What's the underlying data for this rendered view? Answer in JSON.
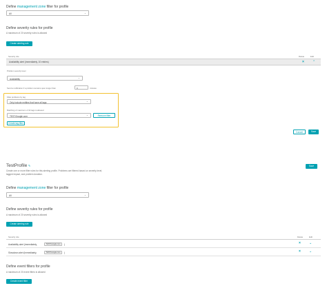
{
  "profile1": {
    "mgmt_prefix": "Define ",
    "mgmt_link": "management zone",
    "mgmt_suffix": " filter for profile",
    "mgmt_select": "All",
    "severity_title": "Define severity rules for profile",
    "severity_hint": "A maximum of 20 severity rules is allowed",
    "create_rule_btn": "Create alerting rule",
    "col_severity": "Severity rule",
    "col_delete": "Delete",
    "col_edit": "Edit",
    "expanded_row_label": "Availability alert (immediately, 10 entries)",
    "problem_severity_label": "Problem severity level",
    "problem_severity_value": "Availability",
    "notification_prefix": "Send a notification if a problem remains open longer than",
    "notification_value": "0",
    "notification_suffix": "minutes",
    "filter_by_tag_label": "Filter problems by tag",
    "filter_by_tag_value": "Only include entities that have all tags",
    "tag_matching_label": "Matching of maximum of 10 tags is allowed",
    "tag_value": "TEST:Google.com",
    "remove_filter_btn": "Remove filter",
    "create_tag_filter_btn": "Create tag filter",
    "cancel_btn": "Cancel",
    "save_btn": "Save"
  },
  "profile2": {
    "name": "TestProfile",
    "description": "Create one or more filter rules for this alerting profile. Problems are filtered based on severity level, tagged impact, and problem duration.",
    "save_btn": "Save",
    "mgmt_prefix": "Define ",
    "mgmt_link": "management zone",
    "mgmt_suffix": " filter for profile",
    "mgmt_select": "All",
    "severity_title": "Define severity rules for profile",
    "severity_hint": "A maximum of 20 severity rules is allowed",
    "create_rule_btn": "Create alerting rule",
    "col_severity": "Severity rule",
    "col_delete": "Delete",
    "col_edit": "Edit",
    "rows": [
      {
        "label": "Availability alert (immediately,",
        "tag": "TEST:Google.com",
        "suffix": ")"
      },
      {
        "label": "Slowdown alert (immediately,",
        "tag": "TEST:Google.com",
        "suffix": ")"
      }
    ],
    "event_title": "Define event filters for profile",
    "event_hint": "A maximum of 20 event filters is allowed",
    "create_event_btn": "Create event filter"
  },
  "colors": {
    "accent": "#00a1b2",
    "highlight": "#f2c12e"
  },
  "icons": {
    "delete": "close-icon",
    "edit": "chevron-down-icon",
    "collapse": "chevron-up-icon",
    "select": "chevron-down-icon",
    "pencil": "pencil-icon"
  }
}
